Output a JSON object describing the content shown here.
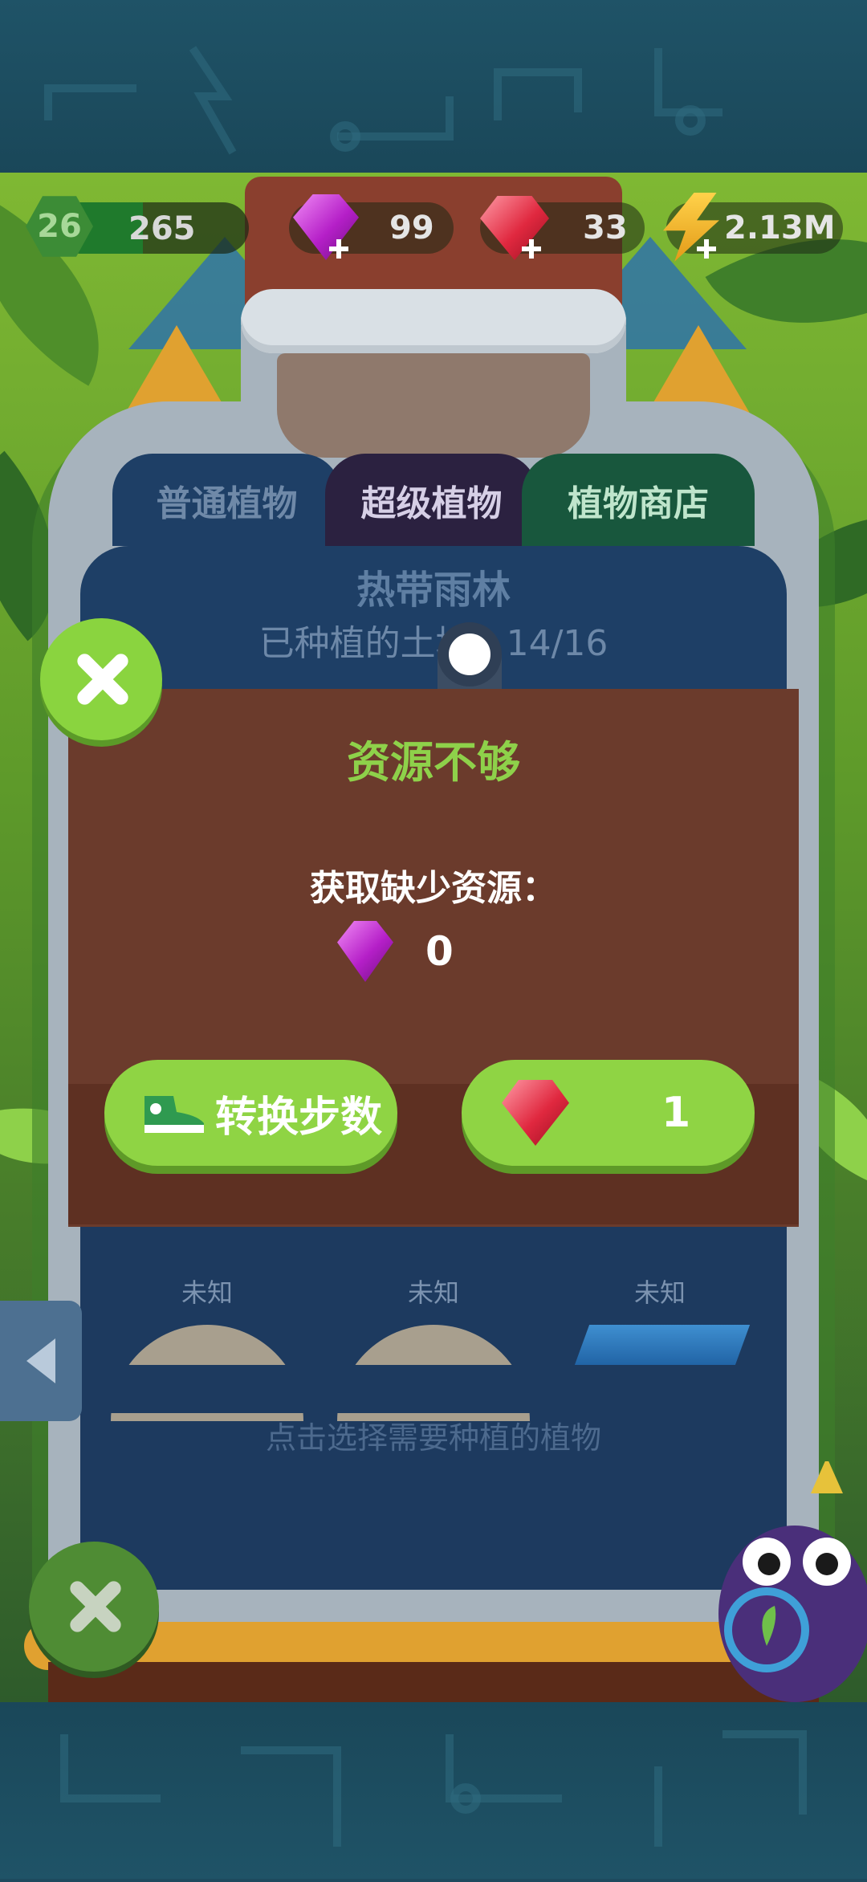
{
  "hud": {
    "level": "26",
    "xp": "265",
    "xp_fill_fraction": 0.45,
    "purple_gems": "99",
    "red_gems": "33",
    "energy": "2.13M"
  },
  "tabs": [
    {
      "label": "普通植物"
    },
    {
      "label": "超级植物"
    },
    {
      "label": "植物商店"
    }
  ],
  "panel": {
    "title": "热带雨林",
    "planted": "已种植的土地：14/16",
    "slots": [
      {
        "label": "未知"
      },
      {
        "label": "未知"
      },
      {
        "label": "未知"
      }
    ],
    "hint": "点击选择需要种植的植物"
  },
  "dialog": {
    "title": "资源不够",
    "message": "获取缺少资源：",
    "missing_resource_count": "0",
    "convert_button": "转换步数",
    "gem_button_cost": "1"
  },
  "colors": {
    "accent_green": "#8fd444",
    "dialog_brown": "#6b3b2c",
    "panel_blue": "#1e3f66"
  },
  "icons": [
    "level-hex-icon",
    "purple-gem-icon",
    "red-gem-icon",
    "lightning-icon",
    "plus-icon",
    "close-icon",
    "sneaker-icon",
    "back-arrow-icon"
  ]
}
